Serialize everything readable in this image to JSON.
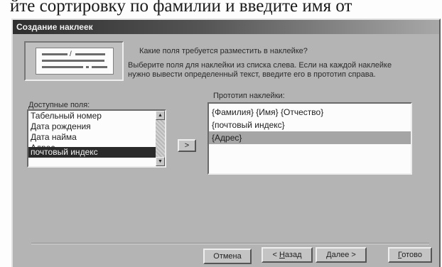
{
  "caption_above": "йте сортировку по фамилии и введите имя от",
  "window": {
    "title": "Создание наклеек"
  },
  "intro": {
    "question": "Какие поля требуется разместить в наклейке?",
    "instruction_line1": "Выберите поля для наклейки из списка слева. Если на каждой наклейке",
    "instruction_line2": "нужно вывести определенный текст, введите его в прототип справа."
  },
  "available_fields": {
    "caption": "Доступные поля:",
    "items": [
      "Табельный номер",
      "Дата рождения",
      "Дата найма",
      "Адрес",
      "почтовый индекс"
    ],
    "selected": "почтовый индекс"
  },
  "move_button": {
    "label": ">"
  },
  "prototype": {
    "caption": "Прототип наклейки:",
    "lines": [
      "{Фамилия} {Имя} {Отчество}",
      "{почтовый индекс}",
      "{Адрес}"
    ],
    "highlighted_line": "{Адрес}"
  },
  "footer": {
    "cancel": "Отмена",
    "back_prefix": "< ",
    "back_key": "Н",
    "back_rest": "азад",
    "next_key": "Д",
    "next_rest": "алее >",
    "finish_key": "Г",
    "finish_rest": "отово"
  }
}
